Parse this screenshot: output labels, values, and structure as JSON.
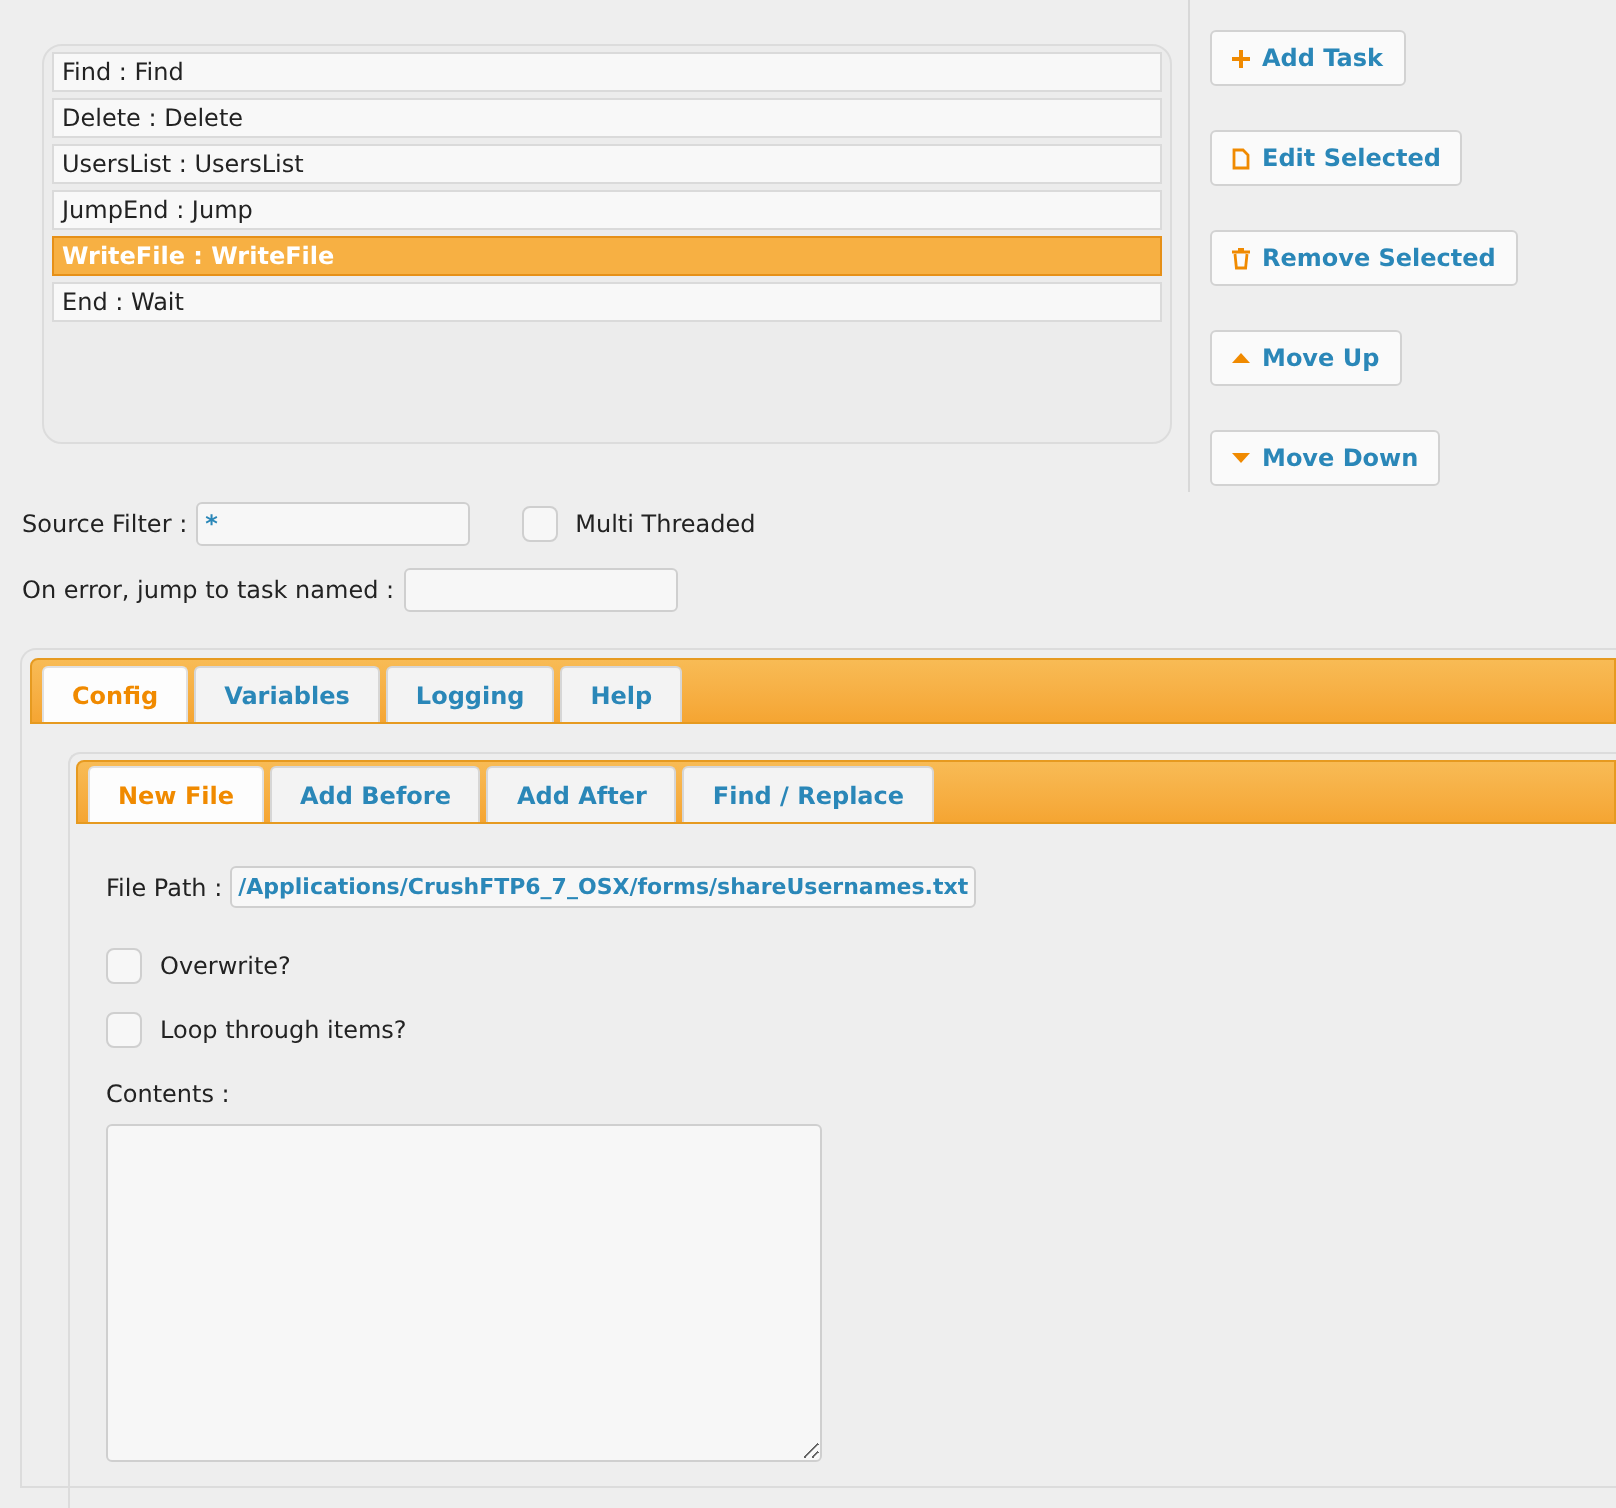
{
  "tasks": [
    {
      "label": "Find : Find",
      "selected": false
    },
    {
      "label": "Delete : Delete",
      "selected": false
    },
    {
      "label": "UsersList : UsersList",
      "selected": false
    },
    {
      "label": "JumpEnd : Jump",
      "selected": false
    },
    {
      "label": "WriteFile : WriteFile",
      "selected": true
    },
    {
      "label": "End : Wait",
      "selected": false
    }
  ],
  "actions": [
    {
      "label": "Add Task",
      "kind": "plus"
    },
    {
      "label": "Edit Selected",
      "kind": "file"
    },
    {
      "label": "Remove Selected",
      "kind": "trash"
    },
    {
      "label": "Move Up",
      "kind": "up"
    },
    {
      "label": "Move Down",
      "kind": "down"
    }
  ],
  "source_filter": {
    "label": "Source Filter :",
    "value": "*"
  },
  "multi_threaded": {
    "label": "Multi Threaded",
    "checked": false
  },
  "on_error": {
    "label": "On error, jump to task named :"
  },
  "tabs": [
    {
      "label": "Config",
      "selected": true
    },
    {
      "label": "Variables",
      "selected": false
    },
    {
      "label": "Logging",
      "selected": false
    },
    {
      "label": "Help",
      "selected": false
    }
  ],
  "subtabs": [
    {
      "label": "New File",
      "selected": true
    },
    {
      "label": "Add Before",
      "selected": false
    },
    {
      "label": "Add After",
      "selected": false
    },
    {
      "label": "Find / Replace",
      "selected": false
    }
  ],
  "file_path": {
    "label": "File Path :",
    "value": "/Applications/CrushFTP6_7_OSX/forms/shareUsernames.txt"
  },
  "options": [
    {
      "label": "Overwrite?",
      "checked": false
    },
    {
      "label": "Loop through items?",
      "checked": false
    }
  ],
  "contents": {
    "label": "Contents :"
  }
}
